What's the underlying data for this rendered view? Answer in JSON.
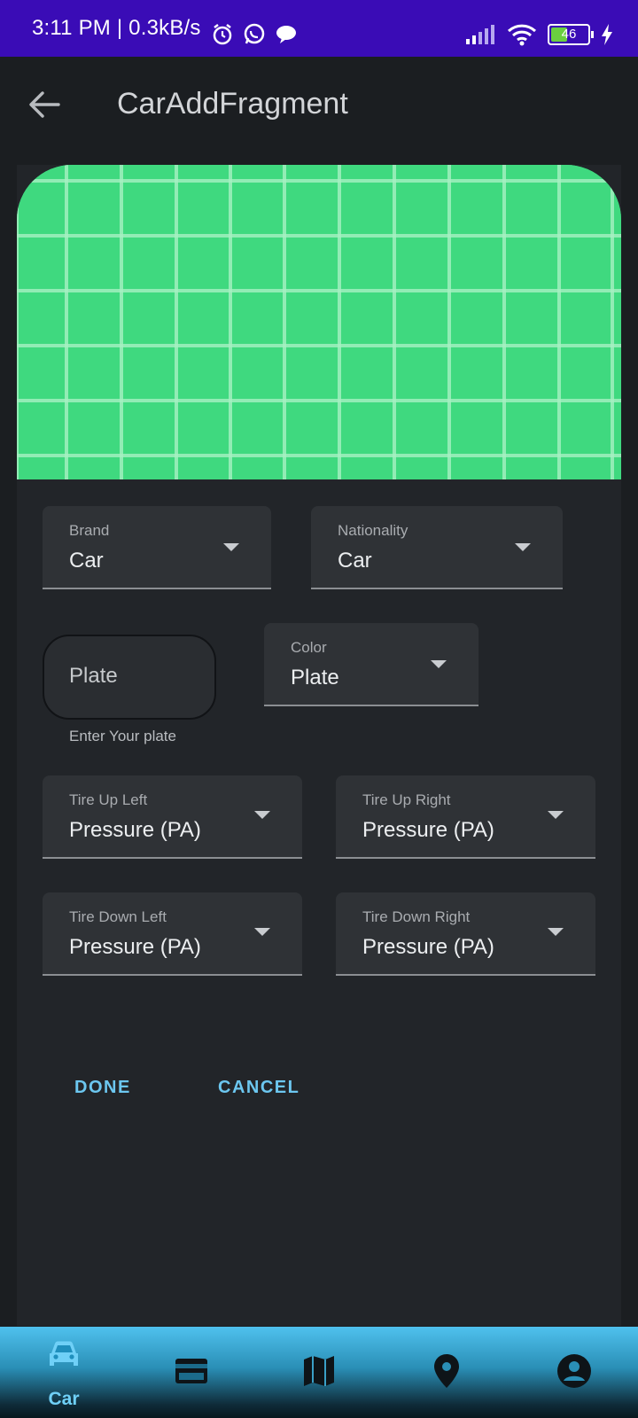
{
  "status": {
    "time_speed": "3:11 PM | 0.3kB/s",
    "battery": "46"
  },
  "appbar": {
    "title": "CarAddFragment"
  },
  "form": {
    "brand": {
      "label": "Brand",
      "value": "Car"
    },
    "nationality": {
      "label": "Nationality",
      "value": "Car"
    },
    "plate": {
      "placeholder": "Plate",
      "helper": "Enter Your plate"
    },
    "color": {
      "label": "Color",
      "value": "Plate"
    },
    "tire_up_left": {
      "label": "Tire Up Left",
      "value": "Pressure (PA)"
    },
    "tire_up_right": {
      "label": "Tire Up Right",
      "value": "Pressure (PA)"
    },
    "tire_down_left": {
      "label": "Tire Down Left",
      "value": "Pressure (PA)"
    },
    "tire_down_right": {
      "label": "Tire Down Right",
      "value": "Pressure (PA)"
    }
  },
  "actions": {
    "done": "DONE",
    "cancel": "CANCEL"
  },
  "bottom_nav": {
    "active": "car",
    "items": [
      {
        "icon": "car-icon",
        "label": "Car"
      },
      {
        "icon": "card-icon",
        "label": ""
      },
      {
        "icon": "map-icon",
        "label": ""
      },
      {
        "icon": "location-pin-icon",
        "label": ""
      },
      {
        "icon": "account-icon",
        "label": ""
      }
    ]
  },
  "colors": {
    "status_bar": "#3a0cb6",
    "hero_green": "#3fd97f",
    "accent": "#6cc7f0"
  }
}
